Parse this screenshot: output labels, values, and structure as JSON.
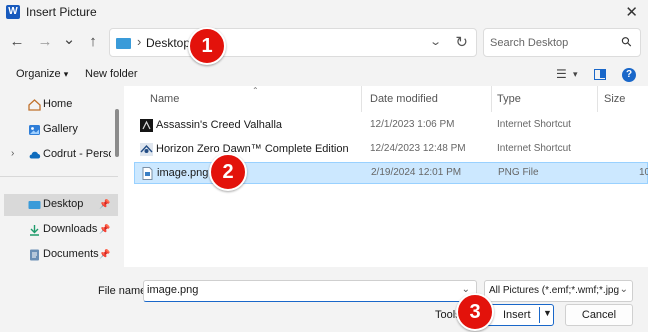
{
  "window": {
    "title": "Insert Picture",
    "app_badge": "W"
  },
  "nav": {
    "back": "←",
    "forward": "→",
    "recent": "⌄",
    "up": "↑"
  },
  "address": {
    "separator": "›",
    "path": "Desktop",
    "drop": "⌄",
    "refresh": "↻"
  },
  "search": {
    "placeholder": "Search Desktop",
    "icon": "search-icon"
  },
  "toolbar": {
    "organize_label": "Organize",
    "organize_arrow": "▾",
    "new_folder_label": "New folder",
    "view_icon": "☰",
    "view_arrow": "▾",
    "help": "?"
  },
  "sidebar": {
    "items": [
      {
        "label": "Home",
        "icon": "home-icon"
      },
      {
        "label": "Gallery",
        "icon": "gallery-icon"
      },
      {
        "label": "Codrut - Personal",
        "icon": "cloud-icon",
        "expand": "›"
      },
      {
        "label": "Desktop",
        "icon": "desktop-icon",
        "pin": "📌"
      },
      {
        "label": "Downloads",
        "icon": "download-icon",
        "pin": "📌"
      },
      {
        "label": "Documents",
        "icon": "documents-icon",
        "pin": "📌"
      }
    ]
  },
  "columns": {
    "name": "Name",
    "date": "Date modified",
    "type": "Type",
    "size": "Size"
  },
  "files": [
    {
      "name": "Assassin's Creed Valhalla",
      "date": "12/1/2023 1:06 PM",
      "type": "Internet Shortcut",
      "size": ""
    },
    {
      "name": "Horizon Zero Dawn™ Complete Edition",
      "date": "12/24/2023 12:48 PM",
      "type": "Internet Shortcut",
      "size": ""
    },
    {
      "name": "image.png",
      "date": "2/19/2024 12:01 PM",
      "type": "PNG File",
      "size": "10"
    }
  ],
  "bottom": {
    "filename_label": "File name:",
    "filename_value": "image.png",
    "filter_value": "All Pictures (*.emf;*.wmf;*.jpg;*.",
    "tools_label": "Tools",
    "insert_label": "Insert",
    "cancel_label": "Cancel"
  },
  "steps": [
    "1",
    "2",
    "3"
  ],
  "colors": {
    "accent": "#1967c9",
    "marker": "#e3120b",
    "selection": "#cce8ff"
  }
}
